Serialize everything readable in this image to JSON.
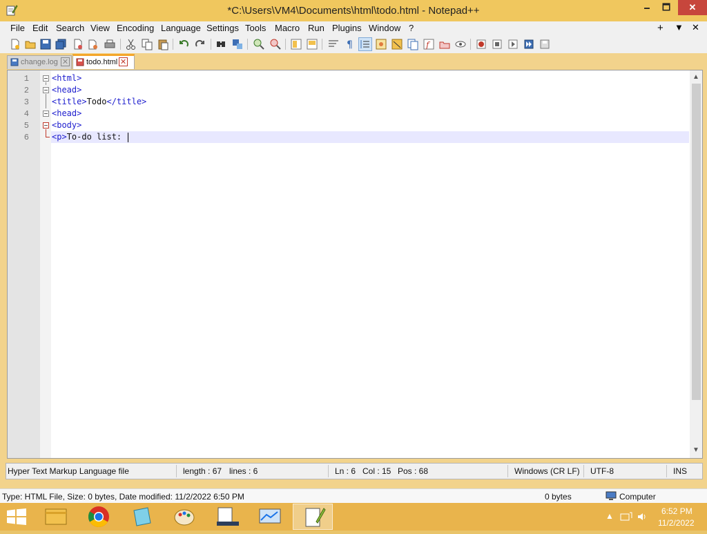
{
  "window": {
    "title": "*C:\\Users\\VM4\\Documents\\html\\todo.html - Notepad++",
    "min_label": "🗕",
    "max_label": "🗖",
    "close_label": "✕"
  },
  "menu": {
    "items": [
      "File",
      "Edit",
      "Search",
      "View",
      "Encoding",
      "Language",
      "Settings",
      "Tools",
      "Macro",
      "Run",
      "Plugins",
      "Window",
      "?"
    ],
    "right_plus": "+",
    "right_dropdown": "▼",
    "right_close": "✕"
  },
  "tabs": [
    {
      "label": "change.log",
      "active": false
    },
    {
      "label": "todo.html",
      "active": true
    }
  ],
  "tab_close_glyph": "✕",
  "editor": {
    "line_numbers": [
      "1",
      "2",
      "3",
      "4",
      "5",
      "6"
    ],
    "lines": [
      {
        "tag_open": "<html>",
        "text": "",
        "tag_close": ""
      },
      {
        "tag_open": "<head>",
        "text": "",
        "tag_close": ""
      },
      {
        "tag_open": "<title>",
        "text": "Todo",
        "tag_close": "</title>"
      },
      {
        "tag_open": "<head>",
        "text": "",
        "tag_close": ""
      },
      {
        "tag_open": "<body>",
        "text": "",
        "tag_close": ""
      },
      {
        "tag_open": "<p>",
        "text": "To-do list:",
        "tag_close": ""
      }
    ]
  },
  "statusbar": {
    "file_type": "Hyper Text Markup Language file",
    "length": "length : 67",
    "lines": "lines : 6",
    "ln": "Ln : 6",
    "col": "Col : 15",
    "pos": "Pos : 68",
    "eol": "Windows (CR LF)",
    "encoding": "UTF-8",
    "mode": "INS"
  },
  "explorer_status": {
    "details": "Type: HTML File, Size: 0 bytes, Date modified: 11/2/2022 6:50 PM",
    "size": "0 bytes",
    "location": "Computer"
  },
  "taskbar": {
    "apps": [
      "file-explorer-icon",
      "chrome-icon",
      "notepad-icon",
      "paint-icon",
      "task-manager-icon",
      "system-monitor-icon",
      "notepad-plus-plus-icon"
    ],
    "time": "6:52 PM",
    "date": "11/2/2022"
  },
  "colors": {
    "title_bar": "#f0c75e",
    "taskbar": "#e9b44c",
    "tag": "#1d1dce",
    "current_line": "#e8e8ff",
    "active_tab_accent": "#f4a62a"
  }
}
